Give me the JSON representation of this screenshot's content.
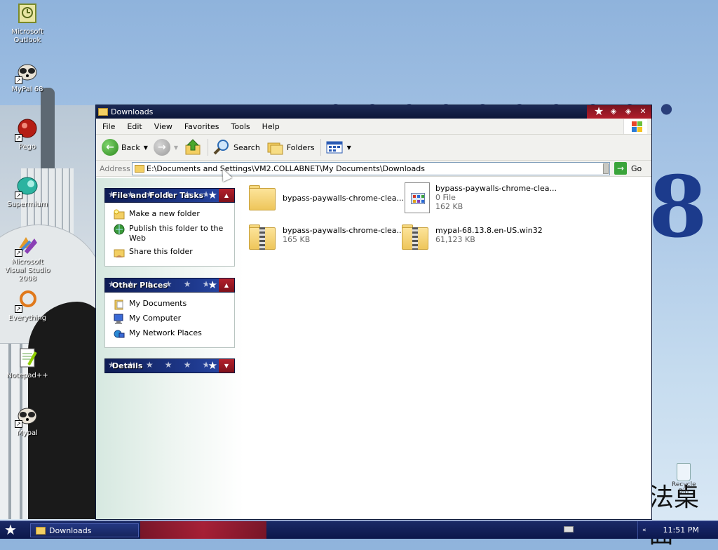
{
  "desktop": {
    "icons": [
      {
        "label": "Microsoft Outlook",
        "icon": "outlook-icon"
      },
      {
        "label": "MyPal 68",
        "icon": "raccoon-icon"
      },
      {
        "label": "Pego",
        "icon": "pego-icon"
      },
      {
        "label": "Supermium",
        "icon": "supermium-icon"
      },
      {
        "label": "Microsoft Visual Studio 2008",
        "icon": "visual-studio-icon"
      },
      {
        "label": "Everything",
        "icon": "everything-icon"
      },
      {
        "label": "Notepad++",
        "icon": "notepadpp-icon"
      },
      {
        "label": "Mypal",
        "icon": "raccoon-icon"
      }
    ],
    "recycle_bin_label": "Recycle Bin",
    "background_text": "法桌面"
  },
  "window": {
    "title": "Downloads",
    "menu": [
      "File",
      "Edit",
      "View",
      "Favorites",
      "Tools",
      "Help"
    ],
    "toolbar": {
      "back_label": "Back",
      "search_label": "Search",
      "folders_label": "Folders"
    },
    "address": {
      "label": "Address",
      "value": "E:\\Documents and Settings\\VM2.COLLABNET\\My Documents\\Downloads",
      "go_label": "Go"
    },
    "task_pane": {
      "file_folder_tasks": {
        "title": "File and Folder Tasks",
        "items": [
          "Make a new folder",
          "Publish this folder to the Web",
          "Share this folder"
        ]
      },
      "other_places": {
        "title": "Other Places",
        "items": [
          "My Documents",
          "My Computer",
          "My Network Places"
        ]
      },
      "details": {
        "title": "Details"
      }
    },
    "files": [
      {
        "name": "bypass-paywalls-chrome-clea...",
        "type": "folder",
        "line2": "",
        "line3": ""
      },
      {
        "name": "bypass-paywalls-chrome-clea...",
        "type": "file",
        "line2": "0 File",
        "line3": "162 KB"
      },
      {
        "name": "bypass-paywalls-chrome-clea...",
        "type": "zip",
        "line2": "165 KB",
        "line3": ""
      },
      {
        "name": "mypal-68.13.8.en-US.win32",
        "type": "zip",
        "line2": "61,123 KB",
        "line3": ""
      }
    ]
  },
  "taskbar": {
    "task_button_label": "Downloads",
    "clock": "11:51 PM"
  },
  "colors": {
    "titlebar": "#0c1638",
    "panel_header": "#1f3a8f",
    "accent_red": "#b11c2a"
  }
}
